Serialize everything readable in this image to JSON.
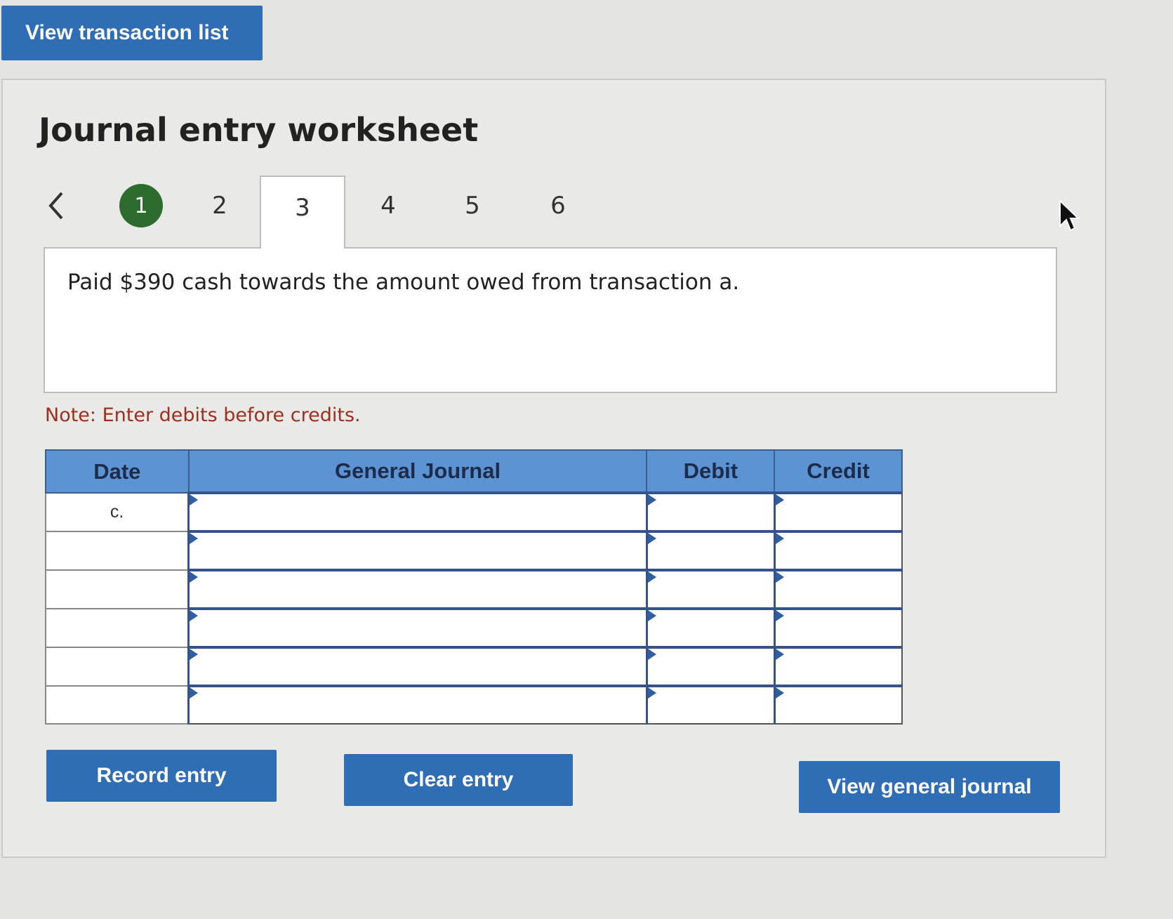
{
  "top_button": {
    "label": "View transaction list"
  },
  "worksheet": {
    "title": "Journal entry worksheet",
    "tabs": [
      {
        "label": "1",
        "state": "completed"
      },
      {
        "label": "2",
        "state": "normal"
      },
      {
        "label": "3",
        "state": "active"
      },
      {
        "label": "4",
        "state": "normal"
      },
      {
        "label": "5",
        "state": "normal"
      },
      {
        "label": "6",
        "state": "normal"
      }
    ],
    "description": "Paid $390 cash towards the amount owed from transaction a.",
    "note": "Note: Enter debits before credits."
  },
  "table": {
    "headers": {
      "date": "Date",
      "general_journal": "General Journal",
      "debit": "Debit",
      "credit": "Credit"
    },
    "rows": [
      {
        "date": "c.",
        "account": "",
        "debit": "",
        "credit": ""
      },
      {
        "date": "",
        "account": "",
        "debit": "",
        "credit": ""
      },
      {
        "date": "",
        "account": "",
        "debit": "",
        "credit": ""
      },
      {
        "date": "",
        "account": "",
        "debit": "",
        "credit": ""
      },
      {
        "date": "",
        "account": "",
        "debit": "",
        "credit": ""
      },
      {
        "date": "",
        "account": "",
        "debit": "",
        "credit": ""
      }
    ]
  },
  "buttons": {
    "record": "Record entry",
    "clear": "Clear entry",
    "view_journal": "View general journal"
  },
  "colors": {
    "button_blue": "#2f6eb5",
    "header_blue": "#5b93d3",
    "completed_green": "#2e6b2e",
    "note_red": "#9b2f1c"
  }
}
